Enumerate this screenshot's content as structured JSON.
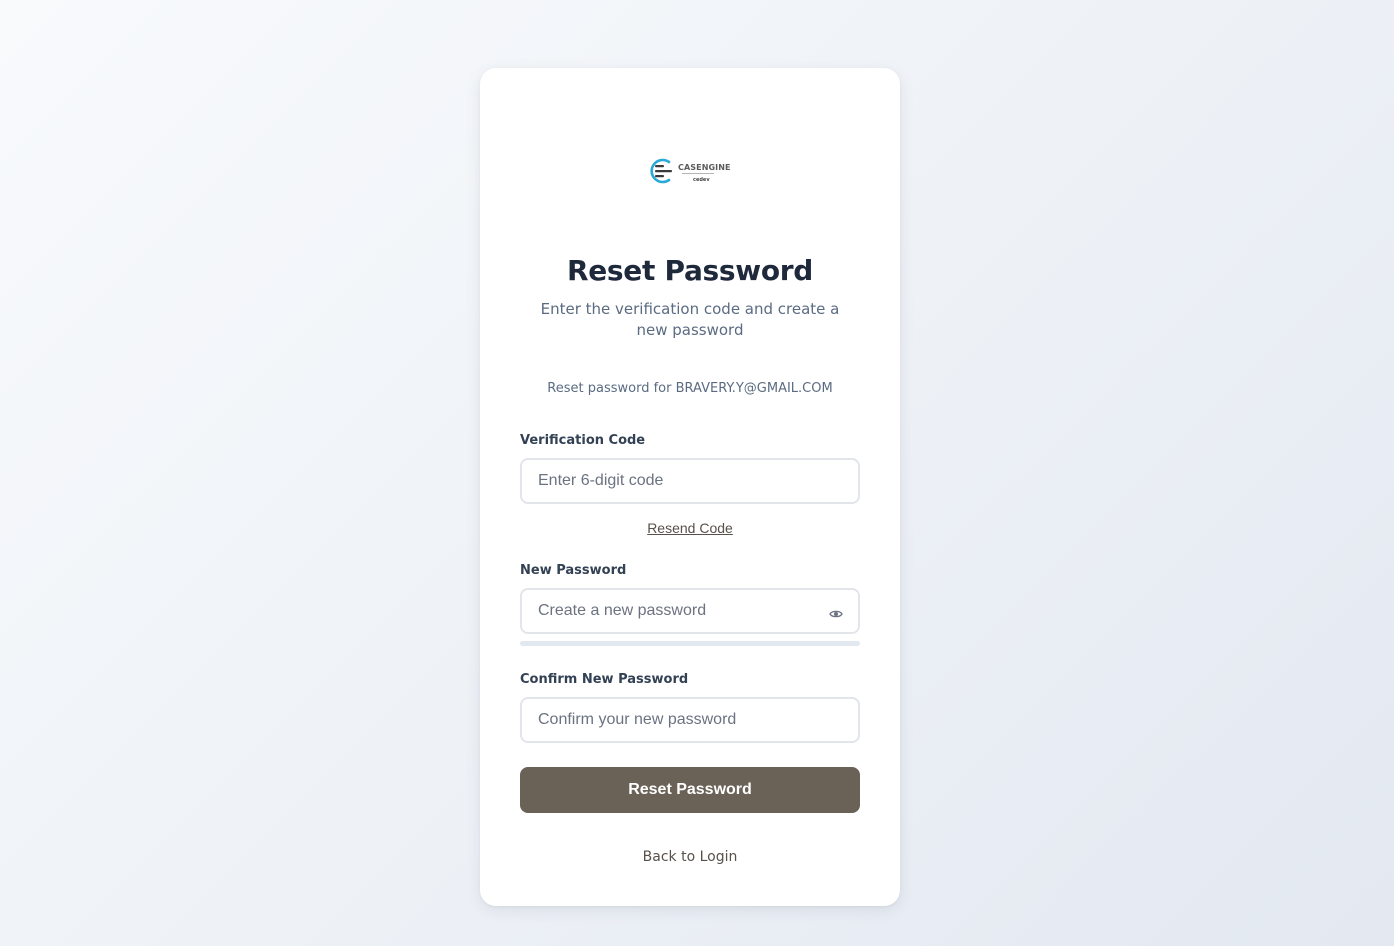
{
  "logo": {
    "brand": "CASENGINE",
    "sub": "cedev"
  },
  "page": {
    "title": "Reset Password",
    "subtitle": "Enter the verification code and create a new password",
    "email_note": "Reset password for BRAVERY.Y@GMAIL.COM"
  },
  "form": {
    "code": {
      "label": "Verification Code",
      "placeholder": "Enter 6-digit code",
      "value": ""
    },
    "resend_label": "Resend Code",
    "new_password": {
      "label": "New Password",
      "placeholder": "Create a new password",
      "value": ""
    },
    "confirm_password": {
      "label": "Confirm New Password",
      "placeholder": "Confirm your new password",
      "value": ""
    },
    "submit_label": "Reset Password",
    "back_label": "Back to Login"
  },
  "icons": {
    "toggle_visibility": "eye-icon"
  },
  "colors": {
    "primary_button": "#6b6257",
    "logo_accent": "#2aa8d8"
  }
}
